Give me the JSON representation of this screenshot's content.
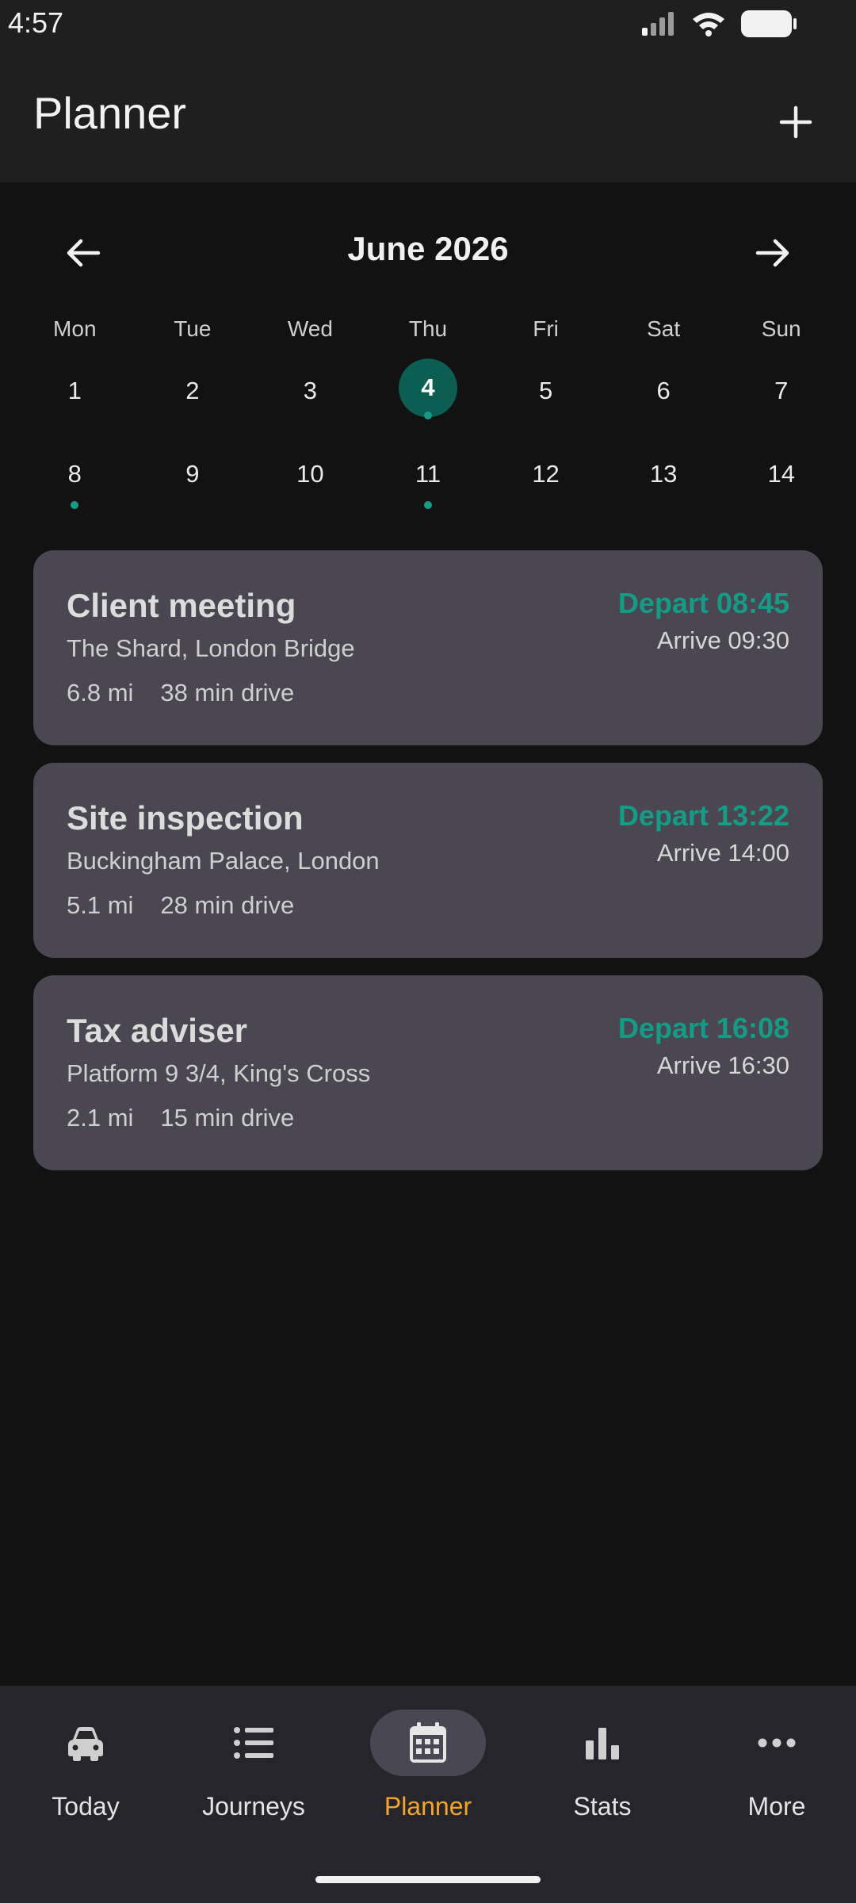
{
  "status_bar": {
    "time": "4:57"
  },
  "app_bar": {
    "title": "Planner",
    "add_icon": "plus-icon"
  },
  "calendar": {
    "month_label": "June 2026",
    "weekdays": [
      "Mon",
      "Tue",
      "Wed",
      "Thu",
      "Fri",
      "Sat",
      "Sun"
    ],
    "days": [
      "1",
      "2",
      "3",
      "4",
      "5",
      "6",
      "7",
      "8",
      "9",
      "10",
      "11",
      "12",
      "13",
      "14"
    ],
    "selected_day": "4",
    "days_with_events": [
      "4",
      "8",
      "11"
    ]
  },
  "journeys": [
    {
      "title": "Client meeting",
      "address": "The Shard, London Bridge",
      "distance": "6.8 mi",
      "duration": "38 min drive",
      "depart": "Depart 08:45",
      "arrive": "Arrive 09:30"
    },
    {
      "title": "Site inspection",
      "address": "Buckingham Palace, London",
      "distance": "5.1 mi",
      "duration": "28 min drive",
      "depart": "Depart 13:22",
      "arrive": "Arrive 14:00"
    },
    {
      "title": "Tax adviser",
      "address": "Platform 9 3/4, King's Cross",
      "distance": "2.1 mi",
      "duration": "15 min drive",
      "depart": "Depart 16:08",
      "arrive": "Arrive 16:30"
    }
  ],
  "bottom_nav": [
    {
      "label": "Today",
      "icon": "car-icon"
    },
    {
      "label": "Journeys",
      "icon": "list-icon"
    },
    {
      "label": "Planner",
      "icon": "calendar-icon",
      "active": true
    },
    {
      "label": "Stats",
      "icon": "bar-chart-icon"
    },
    {
      "label": "More",
      "icon": "more-horizontal-icon"
    }
  ],
  "colors": {
    "accent_teal": "#139c86",
    "selected_day_bg": "#0c5e53",
    "active_nav": "#f5a623",
    "card_bg": "#4a4752"
  }
}
